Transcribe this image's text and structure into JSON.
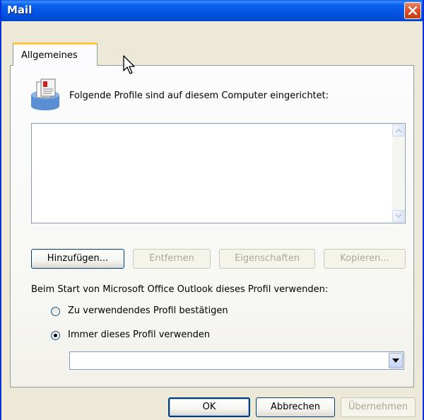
{
  "window": {
    "title": "Mail"
  },
  "tabs": [
    {
      "label": "Allgemeines",
      "active": true
    }
  ],
  "profiles": {
    "label": "Folgende Profile sind auf diesem Computer eingerichtet:",
    "items": []
  },
  "buttons": {
    "add": "Hinzufügen...",
    "remove": "Entfernen",
    "properties": "Eigenschaften",
    "copy": "Kopieren..."
  },
  "startup": {
    "label": "Beim Start von Microsoft Office Outlook dieses Profil verwenden:",
    "options": [
      {
        "label": "Zu verwendendes Profil bestätigen",
        "selected": false
      },
      {
        "label": "Immer dieses Profil verwenden",
        "selected": true
      }
    ],
    "profile_select_value": ""
  },
  "footer": {
    "ok": "OK",
    "cancel": "Abbrechen",
    "apply": "Übernehmen"
  },
  "icons": [
    "close-icon",
    "profiles-icon",
    "scroll-up-icon",
    "scroll-down-icon",
    "dropdown-arrow-icon",
    "mouse-cursor-icon"
  ],
  "colors": {
    "titlebar": "#0054e3",
    "dialog_bg": "#ece9d8",
    "close_button": "#d9502a",
    "tab_highlight": "#ffc83c",
    "radio_selected_dot": "#21a121"
  }
}
